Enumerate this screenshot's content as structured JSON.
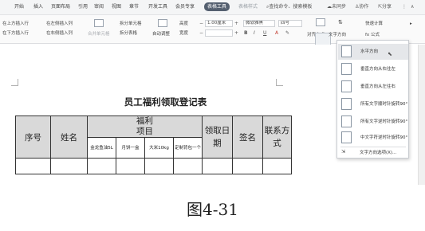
{
  "ribbon": {
    "tabs": [
      "开始",
      "插入",
      "页面布局",
      "引用",
      "审阅",
      "视图",
      "章节",
      "开发工具",
      "会员专享",
      "表格工具",
      "表格样式"
    ],
    "active_tab": "表格工具",
    "search_label": "查找命令、搜索模板",
    "right_items": [
      "未同步",
      "协作",
      "分享"
    ]
  },
  "toolbar": {
    "row1": {
      "insert_above": "在上方插入行",
      "insert_left": "在左侧插入列",
      "split_cell": "拆分单元格",
      "height_label": "高度",
      "height_value": "1.00厘米",
      "font_name": "微软雅黑",
      "font_size": "四号",
      "quick_calc": "快速计算"
    },
    "row2": {
      "insert_below": "在下方插入行",
      "insert_right": "在右侧插入列",
      "merge_cell": "合并单元格",
      "split_table": "拆分表格",
      "autofit": "自动调整",
      "width_label": "宽度",
      "bold": "B",
      "italic": "I",
      "underline": "U",
      "font_color": "A",
      "align_label": "对齐方式",
      "text_direction_label": "文字方向",
      "formula_label": "fx 公式"
    }
  },
  "document": {
    "title": "员工福利领取登记表",
    "headers": {
      "seq": "序号",
      "name": "姓名",
      "benefit_line1": "福利",
      "benefit_line2": "项目",
      "date": "领取日期",
      "sign": "签名",
      "contact": "联系方式"
    },
    "items": [
      "金龙鱼油5L",
      "月饼一盒",
      "大米10kg",
      "定制背包一个"
    ]
  },
  "dropdown": {
    "items": [
      "水平方向",
      "垂直方向从右往左",
      "垂直方向从左往右",
      "所有文字顺时针旋转90°",
      "所有文字逆时针旋转90°",
      "中文字符逆时针旋转90°"
    ],
    "more_label": "文字方向选项(X)..."
  },
  "caption": "图4-31"
}
